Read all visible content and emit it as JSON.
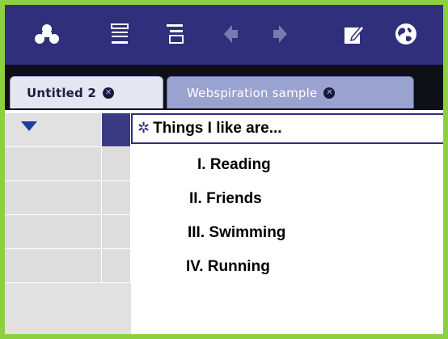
{
  "toolbar": {
    "icons": [
      {
        "name": "diagram-view-icon"
      },
      {
        "name": "outline-view-icon"
      },
      {
        "name": "arrange-icon"
      },
      {
        "name": "back-arrow-icon"
      },
      {
        "name": "forward-arrow-icon"
      },
      {
        "name": "edit-note-icon"
      },
      {
        "name": "globe-icon"
      }
    ]
  },
  "tabs": [
    {
      "label": "Untitled 2",
      "active": true
    },
    {
      "label": "Webspiration sample",
      "active": false
    }
  ],
  "outline": {
    "topic": "Things I like are...",
    "items": [
      {
        "label": "I. Reading"
      },
      {
        "label": "II. Friends"
      },
      {
        "label": "III. Swimming"
      },
      {
        "label": "IV. Running"
      }
    ]
  },
  "colors": {
    "border": "#8cd03f",
    "toolbar": "#2f2f7b",
    "tab_strip": "#0f0f17",
    "active_tab": "#e4e6f1",
    "inactive_tab": "#9aa2cf"
  }
}
